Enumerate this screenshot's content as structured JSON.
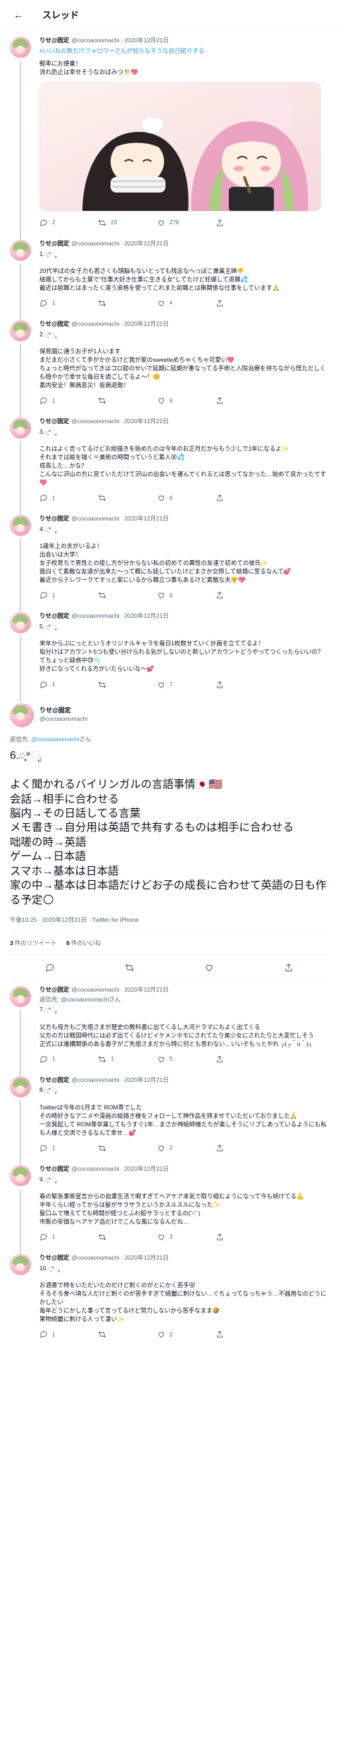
{
  "header": {
    "title": "スレッド"
  },
  "author": {
    "name": "りせ@固定",
    "handle": "@cocoaonomachi"
  },
  "tweets_before": [
    {
      "date": "2020年12月21日",
      "hashtag": "#いいねの数だけフォロワーさんが知らなそうな自己紹介する",
      "text": "軽率にお便乗！\n流れ防止は幸せそうなおばみつ🎋💖",
      "has_image": true,
      "reply": "2",
      "retweet": "23",
      "like": "279"
    },
    {
      "date": "2020年12月21日",
      "text": "1.◌̥*ೃ\n\n20代半ばの女子力も若さくも頭脳もないとっても残念なへっぽこ兼業主婦🐣\n結婚してからも土葉で\"仕事大好き仕事に生きる女\"してたけど妊娠して退職💦\n最近は前職とはまったく違う資格を使ってこれまた前職とは無関係な仕事をしています🙏",
      "reply": "1",
      "retweet": "",
      "like": "4"
    },
    {
      "date": "2020年12月21日",
      "text": "2.◌̥*ೃ\n\n保育園に通うお子が1人います\nまだまだ小さくて手がかかるけど我が家のsweetieめちゃくちゃ可愛い💖\nちょっと時代がなってきはコロ助のせいで延期に延期が重なってる手術と入院治療を待ちながら慌ただしくも穏やかで幸せな毎日を過ごしてるよ〜！🌼\n素内安全！無病息災！疫病退散！",
      "reply": "1",
      "retweet": "",
      "like": "6"
    },
    {
      "date": "2020年12月21日",
      "text": "3.◌̥*ೃ\n\nこれはよく言ってるけどお絵描きを始めたのは今年のお正月だからもう少しで1年になるよ✨\nそれまでは絵を描く＝美術の時間っていうど素人😵💦\n成長した…かな？\nこんなに沢山の方に見ていただけて沢山の出会いを運んでくれるとは思ってなかった…始めて良かったです💖",
      "reply": "1",
      "retweet": "",
      "like": "6"
    },
    {
      "date": "2020年12月21日",
      "text": "4.◌̥*ೃ\n\n1歳年上の夫がいるよ！\n出会いは大学！\n女子校育ちで男性との接し方が分からない私の初めての異性の友達で初めての彼氏✨\n面白くて素敵な友達が出来た〜って概にも話していたけどまさか交際して結婚に至るなんて💕\n最近からテレワークですっと家にいるから職立つ事もあるけど素敵な夫😤💖",
      "reply": "1",
      "retweet": "",
      "like": "9"
    },
    {
      "date": "2020年12月21日",
      "text": "5.◌̥*ೃ\n\n来年からぷにっとというオリジナルキャラを毎日1枚数せていく計画を立ててるよ！\n垢分けはアカウント5つも使い分けられる気がしないのと新しいアカウントどうやってつくったらいいの？てちょっと疑惑中😓🫧\n好きになってくれる方がいたらいいな〜💕",
      "reply": "1",
      "retweet": "",
      "like": "7"
    }
  ],
  "main": {
    "reply_prefix": "返信先:",
    "reply_mention": "@cocoaonomachi",
    "reply_suffix": "さん",
    "text": "6.◌̥*ೃ\n\nよく聞かれるバイリンガルの言語事情🇯🇵🇺🇸\n会話→相手に合わせる\n脳内→その日話してる言葉\nメモ書き→自分用は英語で共有するものは相手に合わせる\n咄嗟の時→英語\nゲーム→日本語\nスマホ→基本は日本語\n家の中→基本は日本語だけどお子の成長に合わせて英語の日も作る予定🌕",
    "time": "午後10:25 · 2020年12月21日 · Twitter for iPhone",
    "retweets_count": "3",
    "retweets_label": "件のリツイート",
    "likes_count": "6",
    "likes_label": "件のいいね"
  },
  "tweets_after": [
    {
      "date": "2020年12月21日",
      "reply_to": "返信先: @cocoaonomachiさん",
      "text": "7.◌̥*ೃ\n\n父方も母方もご先祖さまが歴史の教科書に出てくるし大河ドラマにもよく出てくる\n父方の方は戦国時代には必ず出てくるけどイケメンホモにされてたり美少女にされたりと大変忙しそう\n正式には遺構関係のある書子がご先祖さまだから特に何とも思わない…いいぞもっとやれ ┌(┌＾o＾)┐",
      "reply": "1",
      "retweet": "1",
      "like": "5"
    },
    {
      "date": "2020年12月21日",
      "text": "8.◌̥*ೃ\n\nTwitterは今年の1月まで ROM専でした\nその時好きなアニメや漫画の絵描き様をフォローして神作品を拝ませていただいておりました🙏\n一念発起して ROM専卒業してもうすぐ1年…まさか神絵師様たちが楽しそうにリプしあっているようにも私も人様と交流できるなんて幸せ…💕",
      "reply": "1",
      "retweet": "",
      "like": "2"
    },
    {
      "date": "2020年12月21日",
      "text": "9.◌̥*ೃ\n\n春の緊急事態宣言からの自粛生活で暇すぎてヘアケア本気で取り組むようになって今も続けてる💪\n半年くらい経ってからは髪がサラサラというかスルスルになった✨\n髪口ムで増えてても時間が経つとふわ鉛サラっとするの(˘ᵕ˘ )\n市販の安価なヘアケア品だけでこんな風になるんだね…",
      "reply": "1",
      "retweet": "",
      "like": "3"
    },
    {
      "date": "2020年12月21日",
      "text": "10.◌̥*ೃ\n\nお酒香で柿をいただいたのだけど刺くのがとにかく苦手😵\nそろそろ食べ頃な人だけど刺ぐのが苦手すぎて綺麗に刺けない…ぐちょってなっちゃう…不器用なのどうにかしたい\n毎年どうにかした事って言ってるけど努力しないから苦手なまま🤣\n果物綺麗に刺ける人って凄い✨",
      "reply": "1",
      "retweet": "",
      "like": "2"
    }
  ],
  "icons": {
    "back": "arrow-left-icon",
    "reply": "reply-icon",
    "retweet": "retweet-icon",
    "like": "heart-icon",
    "share": "share-icon"
  },
  "colors": {
    "link": "#1d9bf0",
    "muted": "#536471",
    "thread_line": "#cfd9de"
  }
}
